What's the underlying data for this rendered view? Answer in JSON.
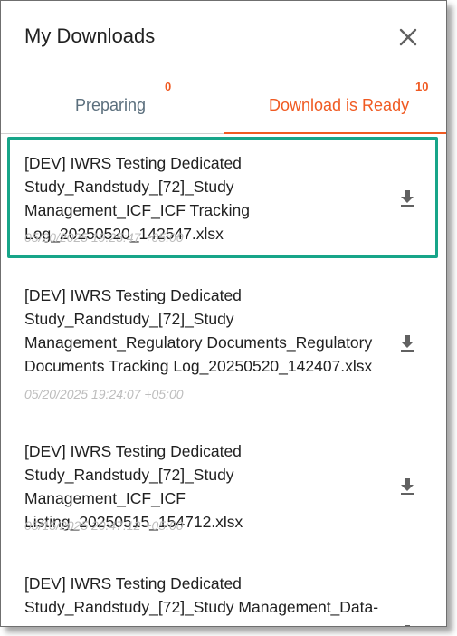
{
  "header": {
    "title": "My Downloads"
  },
  "tabs": [
    {
      "label": "Preparing",
      "count": "0",
      "active": false
    },
    {
      "label": "Download is Ready",
      "count": "10",
      "active": true
    }
  ],
  "colors": {
    "accent": "#f05a22",
    "inactive_tab": "#5b6f7d",
    "selected_border": "#17a589",
    "timestamp": "#bdbdbd"
  },
  "items": [
    {
      "name": "[DEV] IWRS Testing Dedicated Study_Randstudy_[72]_Study Management_ICF_ICF Tracking Log_20250520_142547.xlsx",
      "timestamp": "05/20/2025 19:25:47 +05:00",
      "selected": true
    },
    {
      "name": "[DEV] IWRS Testing Dedicated Study_Randstudy_[72]_Study Management_Regulatory Documents_Regulatory Documents Tracking Log_20250520_142407.xlsx",
      "timestamp": "05/20/2025 19:24:07 +05:00",
      "selected": false
    },
    {
      "name": "[DEV] IWRS Testing Dedicated Study_Randstudy_[72]_Study Management_ICF_ICF Listing_20250515_154712.xlsx",
      "timestamp": "05/15/2025 20:47:12 +05:00",
      "selected": false
    },
    {
      "name": "[DEV] IWRS Testing Dedicated Study_Randstudy_[72]_Study Management_Data-",
      "timestamp": "",
      "selected": false
    }
  ]
}
